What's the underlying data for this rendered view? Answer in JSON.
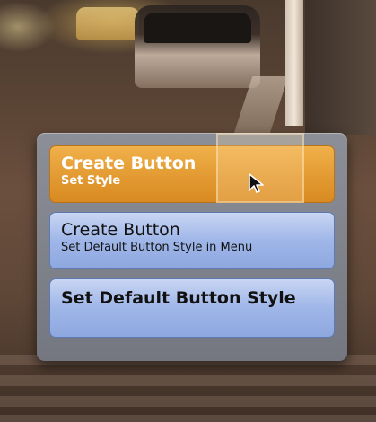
{
  "menu": {
    "items": [
      {
        "title": "Create Button",
        "subtitle": "Set Style",
        "state": "selected"
      },
      {
        "title": "Create Button",
        "subtitle": "Set Default Button Style in Menu",
        "state": "normal"
      },
      {
        "title": "Set Default Button Style",
        "subtitle": "",
        "state": "normal"
      }
    ]
  },
  "colors": {
    "selected_fill": "#e39a32",
    "button_fill": "#9fb6e8",
    "panel_fill": "#80838c"
  },
  "icons": {
    "cursor": "pointer-arrow-icon"
  }
}
